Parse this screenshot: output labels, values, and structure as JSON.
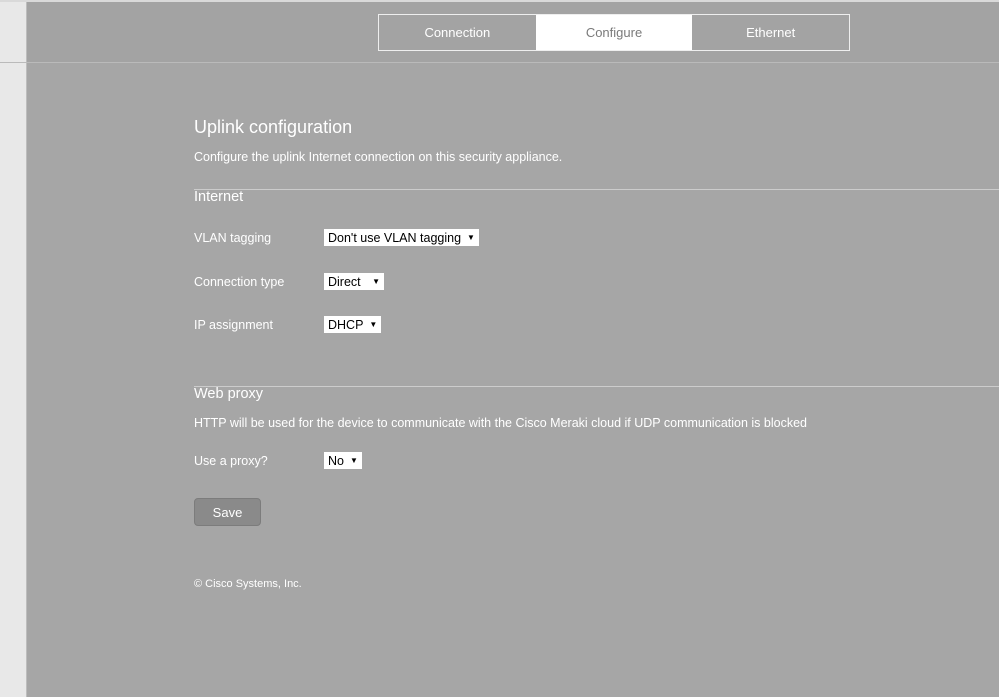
{
  "tabs": [
    {
      "label": "Connection",
      "active": false
    },
    {
      "label": "Configure",
      "active": true
    },
    {
      "label": "Ethernet",
      "active": false
    }
  ],
  "page": {
    "title": "Uplink configuration",
    "description": "Configure the uplink Internet connection on this security appliance."
  },
  "internet": {
    "title": "Internet",
    "fields": [
      {
        "label": "VLAN tagging",
        "value": "Don't use VLAN tagging"
      },
      {
        "label": "Connection type",
        "value": "Direct"
      },
      {
        "label": "IP assignment",
        "value": "DHCP"
      }
    ]
  },
  "web_proxy": {
    "title": "Web proxy",
    "description": "HTTP will be used for the device to communicate with the Cisco Meraki cloud if UDP communication is blocked",
    "use_proxy_label": "Use a proxy?",
    "use_proxy_value": "No"
  },
  "actions": {
    "save_label": "Save"
  },
  "footer": {
    "copyright": "© Cisco Systems, Inc."
  },
  "icons": {
    "dropdown_arrow": "▼"
  }
}
